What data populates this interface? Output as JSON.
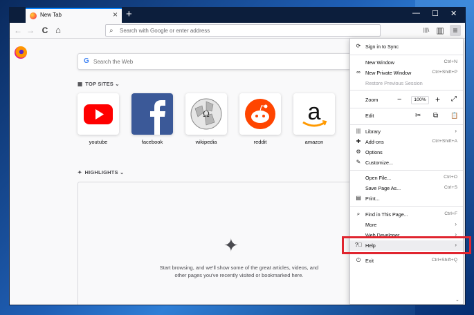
{
  "tab": {
    "title": "New Tab",
    "close": "×",
    "new": "+"
  },
  "window_controls": {
    "minimize": "—",
    "maximize": "☐",
    "close": "✕"
  },
  "toolbar": {
    "back": "←",
    "forward": "→",
    "reload": "C",
    "home": "⌂",
    "library": "|||\\",
    "sidebar": "▥",
    "menu": "≡"
  },
  "urlbar": {
    "placeholder": "Search with Google or enter address"
  },
  "newtab": {
    "search_placeholder": "Search the Web",
    "search_g": "G",
    "top_sites_label": "TOP SITES",
    "highlights_label": "HIGHLIGHTS",
    "chevron": "⌄",
    "top_sites": [
      {
        "label": "youtube"
      },
      {
        "label": "facebook"
      },
      {
        "label": "wikipedia"
      },
      {
        "label": "reddit"
      },
      {
        "label": "amazon"
      }
    ],
    "highlights_message": "Start browsing, and we'll show some of the great articles, videos, and other pages you've recently visited or bookmarked here.",
    "spark": "✦"
  },
  "menu": {
    "sync": "Sign in to Sync",
    "new_window": {
      "label": "New Window",
      "shortcut": "Ctrl+N"
    },
    "private_window": {
      "label": "New Private Window",
      "shortcut": "Ctrl+Shift+P"
    },
    "restore": "Restore Previous Session",
    "zoom": {
      "label": "Zoom",
      "minus": "−",
      "value": "100%",
      "plus": "+",
      "full": "⤢"
    },
    "edit": {
      "label": "Edit",
      "cut": "✂",
      "copy": "⧉",
      "paste": "📋"
    },
    "library": "Library",
    "addons": {
      "label": "Add-ons",
      "shortcut": "Ctrl+Shift+A"
    },
    "options": "Options",
    "customize": "Customize...",
    "open_file": {
      "label": "Open File...",
      "shortcut": "Ctrl+O"
    },
    "save_page": {
      "label": "Save Page As...",
      "shortcut": "Ctrl+S"
    },
    "print": "Print...",
    "find": {
      "label": "Find in This Page...",
      "shortcut": "Ctrl+F"
    },
    "more": "More",
    "web_developer": "Web Developer",
    "help": "Help",
    "exit": {
      "label": "Exit",
      "shortcut": "Ctrl+Shift+Q"
    },
    "arrow": "›"
  },
  "scroll": {
    "down": "⌄"
  }
}
